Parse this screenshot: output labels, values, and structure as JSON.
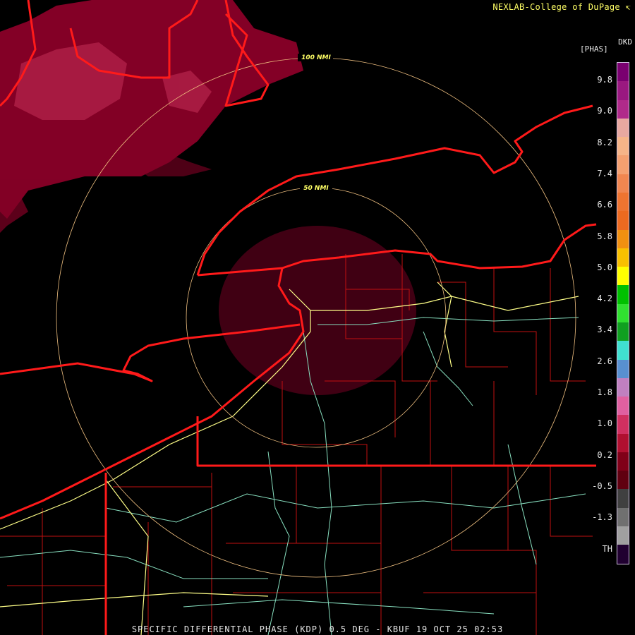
{
  "header": {
    "credit": "NEXLAB-College of DuPage"
  },
  "footer": {
    "caption": "SPECIFIC DIFFERENTIAL PHASE (KDP) 0.5 DEG - KBUF 19 OCT 25 02:53"
  },
  "legend": {
    "product": "DKD",
    "unit": "[PHAS]",
    "ticks": [
      "9.8",
      "9.0",
      "8.2",
      "7.4",
      "6.6",
      "5.8",
      "5.0",
      "4.2",
      "3.4",
      "2.6",
      "1.8",
      "1.0",
      "0.2",
      "-0.5",
      "-1.3",
      "TH"
    ],
    "colors": [
      "#7a0070",
      "#9a1880",
      "#b02a8a",
      "#e8a8a0",
      "#f6b488",
      "#f4a070",
      "#f08650",
      "#ee7430",
      "#ec6a20",
      "#f09010",
      "#f8c000",
      "#ffff00",
      "#00c000",
      "#30e030",
      "#10a020",
      "#40e0d0",
      "#5890d0",
      "#c080c0",
      "#e060a0",
      "#d03060",
      "#b01030",
      "#800018",
      "#600010",
      "#404040",
      "#707070",
      "#a0a0a0",
      "#200030"
    ]
  },
  "rings": [
    {
      "label": "50 NMI"
    },
    {
      "label": "100 NMI"
    }
  ],
  "colors": {
    "state_border": "#ff1a1a",
    "county_border": "#c01010",
    "interstate": "#ffff88",
    "highway": "#88e0c0",
    "range_ring": "#f0c080",
    "echo": "#8a0028"
  },
  "icons": {
    "logo": "nexlab-logo-icon"
  }
}
